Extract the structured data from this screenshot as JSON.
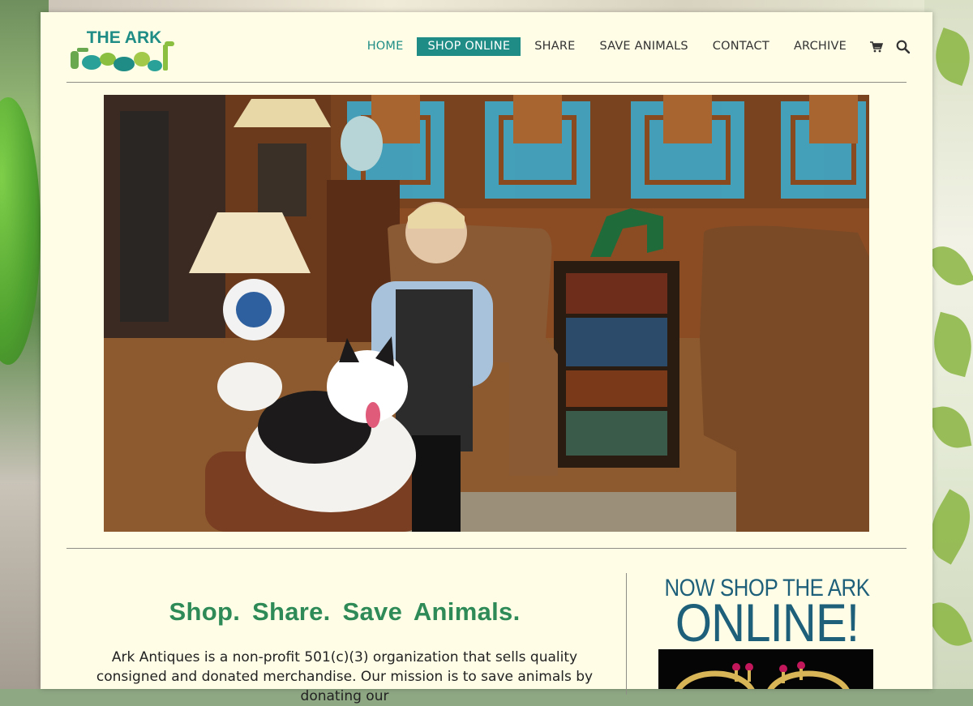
{
  "brand": {
    "logo_text": "THE ARK",
    "accent_color": "#1f8d85",
    "headline_color": "#2e8b57",
    "promo_color": "#1e5f7a"
  },
  "nav": {
    "items": [
      {
        "label": "HOME"
      },
      {
        "label": "SHOP ONLINE"
      },
      {
        "label": "SHARE"
      },
      {
        "label": "SAVE ANIMALS"
      },
      {
        "label": "CONTACT"
      },
      {
        "label": "ARCHIVE"
      }
    ],
    "cart_icon": "cart-icon",
    "search_icon": "search-icon"
  },
  "hero": {
    "image": "shop-owner-with-dog-photo"
  },
  "content": {
    "headline": "Shop.  Share.  Save Animals.",
    "intro": "Ark Antiques is a non-profit 501(c)(3) organization that sells quality consigned and donated merchandise. Our mission is to save animals by donating our"
  },
  "promo": {
    "line1": "NOW SHOP THE ARK",
    "line2": "ONLINE!",
    "image": "jewelry-rings-photo"
  }
}
